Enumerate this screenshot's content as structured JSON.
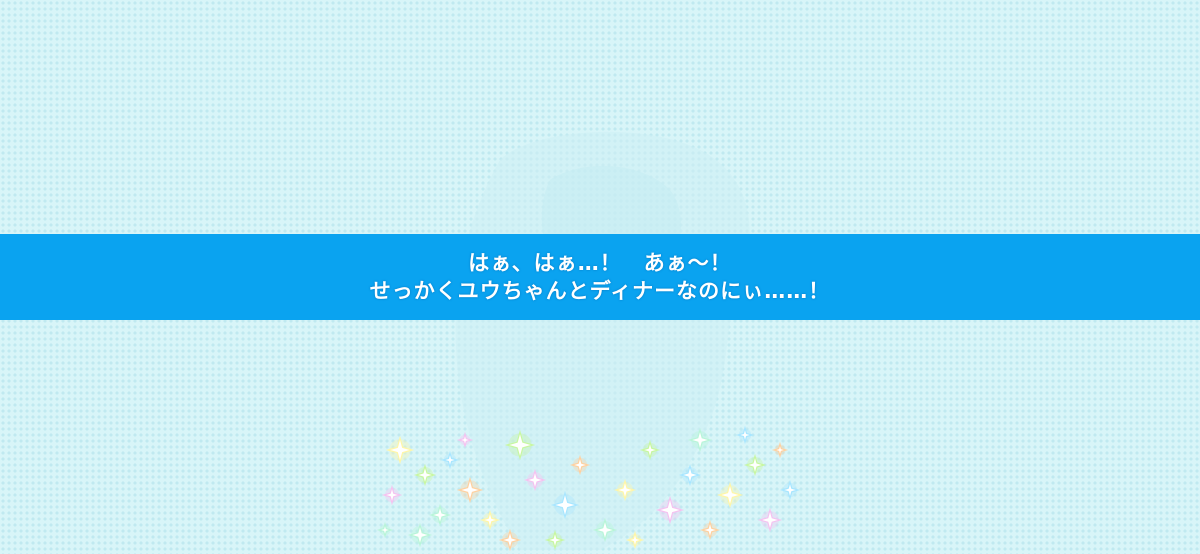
{
  "dialogue": {
    "line1": "はぁ、はぁ…！　あぁ～！",
    "line2": "せっかくユウちゃんとディナーなのにぃ……！"
  },
  "colors": {
    "band": "#0aa3f0",
    "background": "#d8f5f8",
    "text": "#ffffff"
  },
  "effects": {
    "sparkle_icon": "sparkle-cluster-icon"
  }
}
